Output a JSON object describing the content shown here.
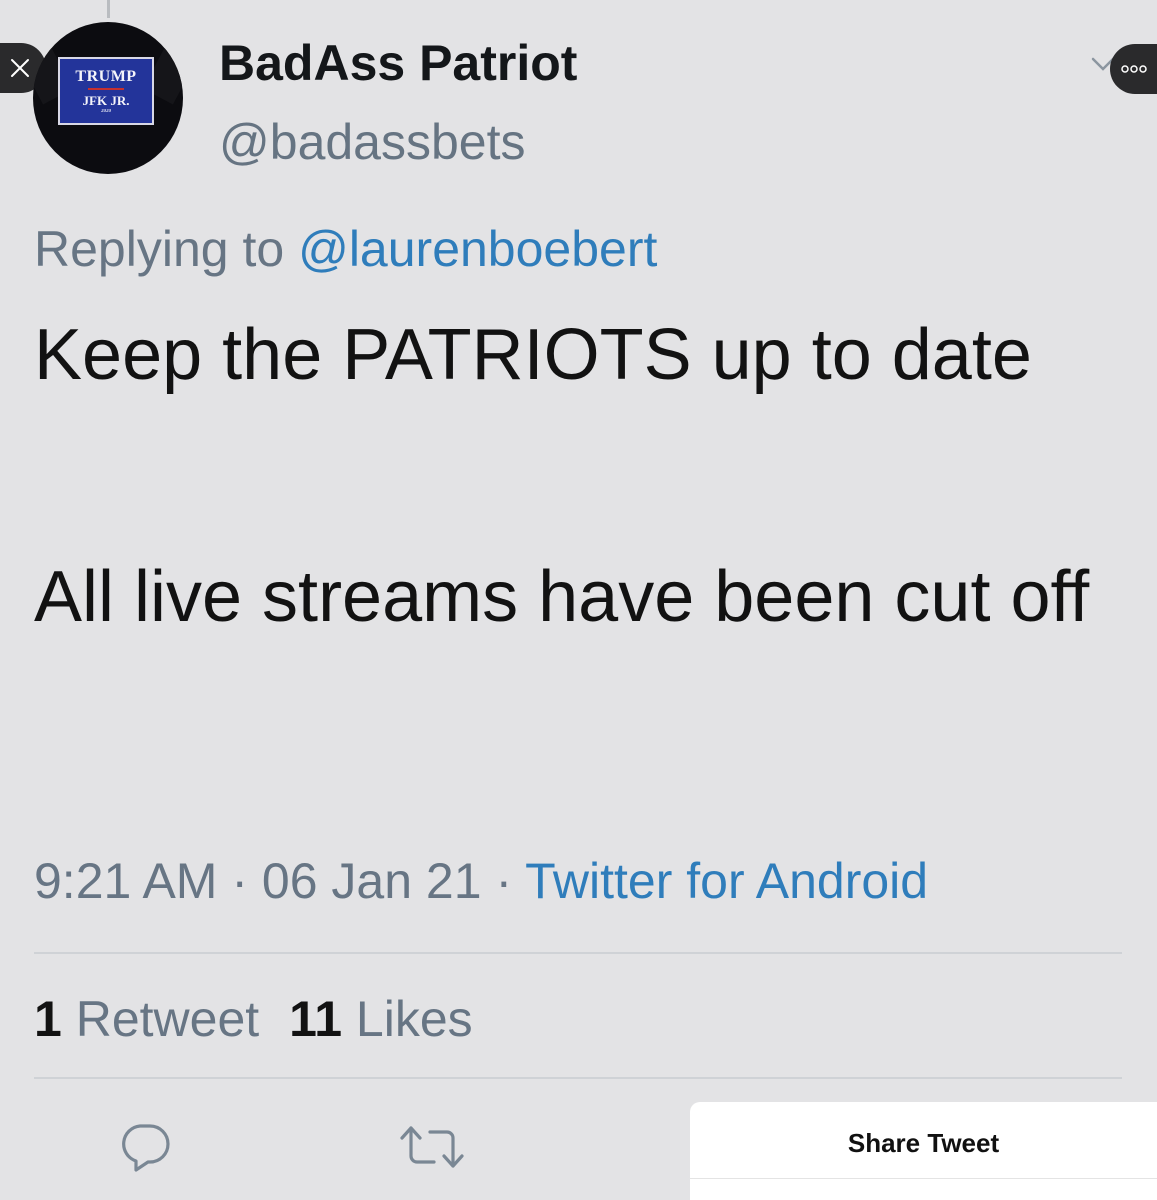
{
  "tweet": {
    "display_name": "BadAss Patriot",
    "handle": "@badassbets",
    "replying_label": "Replying to",
    "replying_to": "@laurenboebert",
    "text_paragraph_1": "Keep the PATRIOTS up to date",
    "text_paragraph_2": "All live streams have been cut off",
    "time": "9:21 AM",
    "date": "06 Jan 21",
    "source": "Twitter for Android",
    "separator": "·",
    "retweet_count": "1",
    "retweet_label": "Retweet",
    "like_count": "11",
    "like_label": "Likes"
  },
  "avatar": {
    "line1": "TRUMP",
    "line2": "JFK JR.",
    "line3": "2020"
  },
  "share_sheet": {
    "title": "Share Tweet"
  },
  "icons": {
    "close": "close-icon",
    "more": "more-dots-icon",
    "caret": "chevron-down-icon",
    "reply": "reply-icon",
    "retweet": "retweet-icon"
  },
  "colors": {
    "background": "#e3e3e5",
    "link": "#2f7dbb",
    "secondary_text": "#677584",
    "primary_text": "#121212"
  }
}
